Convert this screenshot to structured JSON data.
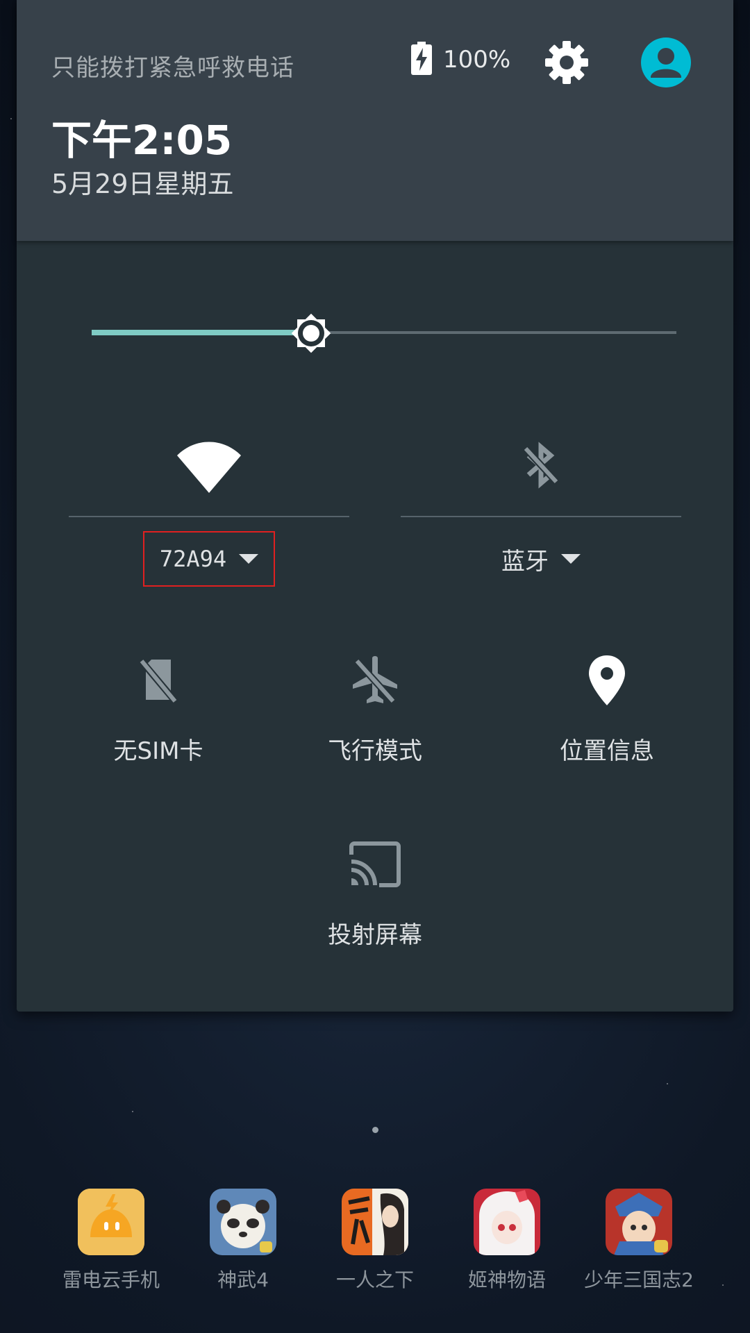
{
  "status": {
    "carrier_text": "只能拨打紧急呼救电话",
    "battery_percent": "100%"
  },
  "header": {
    "time": "下午2:05",
    "date": "5月29日星期五"
  },
  "brightness": {
    "level": 0.375
  },
  "toggles": {
    "wifi": {
      "label": "72A94",
      "active": true
    },
    "bluetooth": {
      "label": "蓝牙",
      "active": false
    }
  },
  "tiles": [
    {
      "label": "无SIM卡",
      "icon": "no-sim-icon",
      "active": false
    },
    {
      "label": "飞行模式",
      "icon": "airplane-icon",
      "active": false
    },
    {
      "label": "位置信息",
      "icon": "location-pin-icon",
      "active": true
    },
    {
      "label": "投射屏幕",
      "icon": "cast-icon",
      "active": false
    }
  ],
  "dock": [
    {
      "label": "雷电云手机",
      "icon": "leidian-cloud-icon"
    },
    {
      "label": "神武4",
      "icon": "shenwu4-icon"
    },
    {
      "label": "一人之下",
      "icon": "yirenzhixia-icon"
    },
    {
      "label": "姬神物语",
      "icon": "jishenwuyu-icon"
    },
    {
      "label": "少年三国志2",
      "icon": "shaonian-sanguozhi2-icon"
    }
  ],
  "colors": {
    "panel": "#263238",
    "header": "#37414a",
    "accent": "#7fcbc4",
    "avatar": "#00bcd4",
    "highlight_box": "#e02020"
  }
}
